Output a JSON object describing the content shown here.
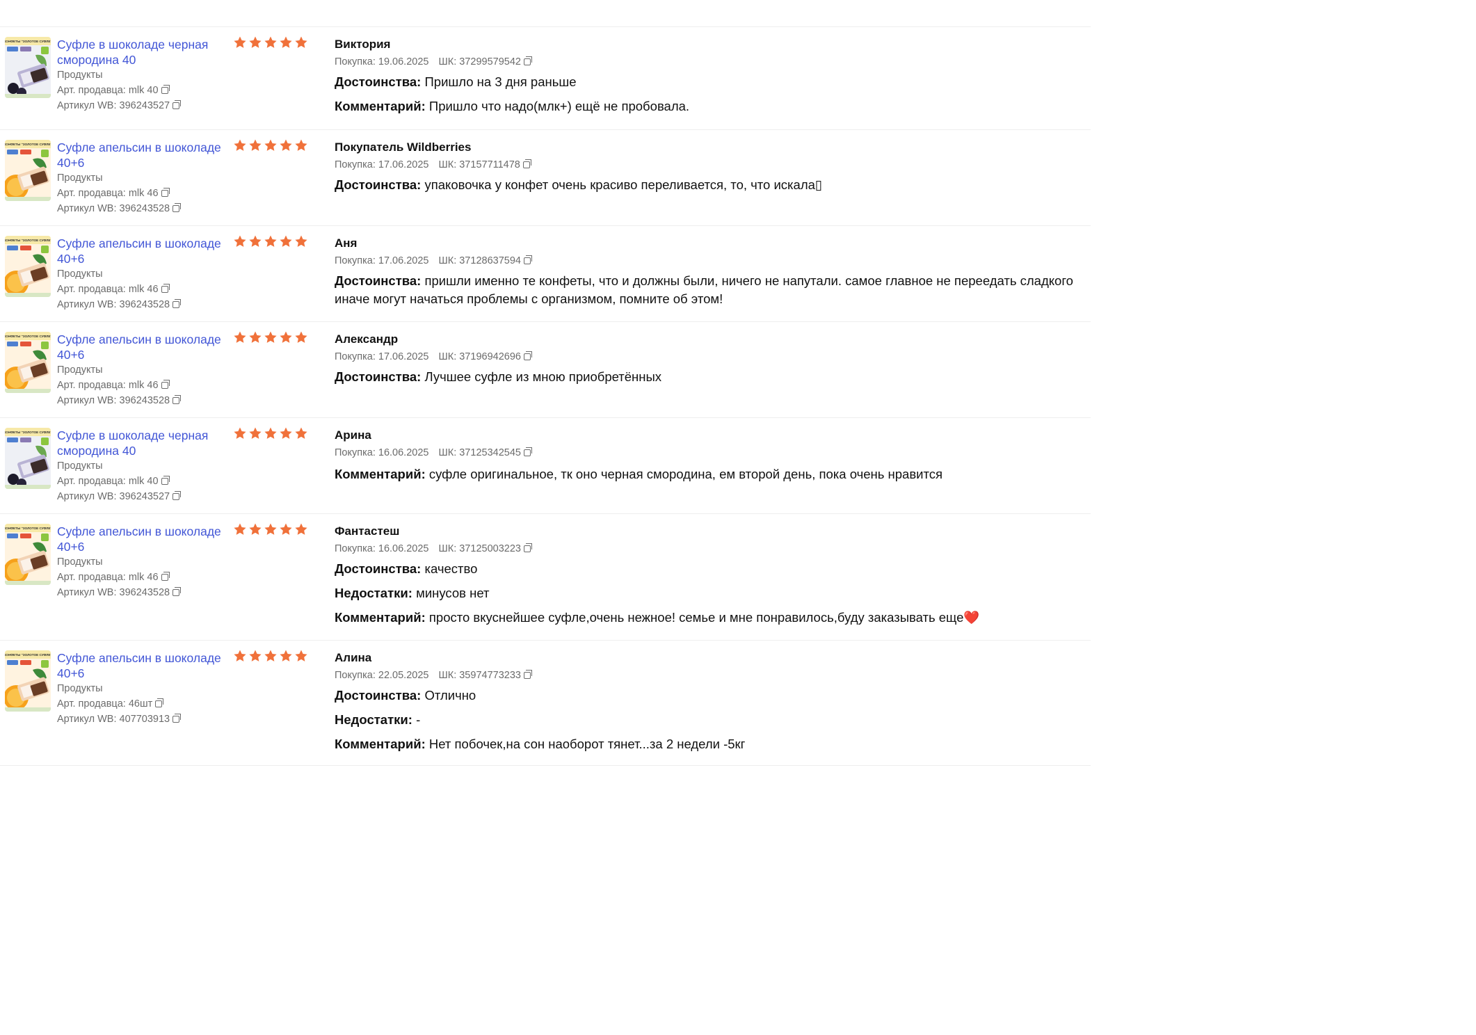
{
  "colors": {
    "link": "#4256d6",
    "star": "#f0713a",
    "muted": "#6b6b6b"
  },
  "reviews": [
    {
      "product_title": "Суфле в шоколаде черная смородина 40",
      "category": "Продукты",
      "seller_article": "Арт. продавца: mlk 40",
      "wb_article": "Артикул WB: 396243527",
      "thumb_variant": "currant",
      "thumb_text": "КОНФЕТЫ \"ЗОЛОТОЕ СУФЛЕ\"",
      "rating": 5,
      "author": "Виктория",
      "purchase": "Покупка: 19.06.2025",
      "barcode": "ШК: 37299579542",
      "pros_label": "Достоинства:",
      "pros": "Пришло на 3 дня раньше",
      "cons_label": "",
      "cons": "",
      "comment_label": "Комментарий:",
      "comment": "Пришло что надо(млк+) ещё не пробовала."
    },
    {
      "product_title": "Суфле апельсин в шоколаде 40+6",
      "category": "Продукты",
      "seller_article": "Арт. продавца: mlk 46",
      "wb_article": "Артикул WB: 396243528",
      "thumb_variant": "orange",
      "thumb_text": "КОНФЕТЫ \"ЗОЛОТОЕ СУФЛЕ\"",
      "rating": 5,
      "author": "Покупатель Wildberries",
      "purchase": "Покупка: 17.06.2025",
      "barcode": "ШК: 37157711478",
      "pros_label": "Достоинства:",
      "pros": "упаковочка у конфет очень красиво переливается, то, что искала▯",
      "cons_label": "",
      "cons": "",
      "comment_label": "",
      "comment": ""
    },
    {
      "product_title": "Суфле апельсин в шоколаде 40+6",
      "category": "Продукты",
      "seller_article": "Арт. продавца: mlk 46",
      "wb_article": "Артикул WB: 396243528",
      "thumb_variant": "orange",
      "thumb_text": "КОНФЕТЫ \"ЗОЛОТОЕ СУФЛЕ\"",
      "rating": 5,
      "author": "Аня",
      "purchase": "Покупка: 17.06.2025",
      "barcode": "ШК: 37128637594",
      "pros_label": "Достоинства:",
      "pros": "пришли именно те конфеты, что и должны были, ничего не напутали. самое главное не переедать сладкого иначе могут начаться проблемы с организмом, помните об этом!",
      "cons_label": "",
      "cons": "",
      "comment_label": "",
      "comment": ""
    },
    {
      "product_title": "Суфле апельсин в шоколаде 40+6",
      "category": "Продукты",
      "seller_article": "Арт. продавца: mlk 46",
      "wb_article": "Артикул WB: 396243528",
      "thumb_variant": "orange",
      "thumb_text": "КОНФЕТЫ \"ЗОЛОТОЕ СУФЛЕ\"",
      "rating": 5,
      "author": "Александр",
      "purchase": "Покупка: 17.06.2025",
      "barcode": "ШК: 37196942696",
      "pros_label": "Достоинства:",
      "pros": "Лучшее суфле из мною приобретённых",
      "cons_label": "",
      "cons": "",
      "comment_label": "",
      "comment": ""
    },
    {
      "product_title": "Суфле в шоколаде черная смородина 40",
      "category": "Продукты",
      "seller_article": "Арт. продавца: mlk 40",
      "wb_article": "Артикул WB: 396243527",
      "thumb_variant": "currant",
      "thumb_text": "КОНФЕТЫ \"ЗОЛОТОЕ СУФЛЕ\"",
      "rating": 5,
      "author": "Арина",
      "purchase": "Покупка: 16.06.2025",
      "barcode": "ШК: 37125342545",
      "pros_label": "",
      "pros": "",
      "cons_label": "",
      "cons": "",
      "comment_label": "Комментарий:",
      "comment": "суфле оригинальное, тк оно черная смородина, ем второй день, пока очень нравится"
    },
    {
      "product_title": "Суфле апельсин в шоколаде 40+6",
      "category": "Продукты",
      "seller_article": "Арт. продавца: mlk 46",
      "wb_article": "Артикул WB: 396243528",
      "thumb_variant": "orange",
      "thumb_text": "КОНФЕТЫ \"ЗОЛОТОЕ СУФЛЕ\"",
      "rating": 5,
      "author": "Фантастеш",
      "purchase": "Покупка: 16.06.2025",
      "barcode": "ШК: 37125003223",
      "pros_label": "Достоинства:",
      "pros": "качество",
      "cons_label": "Недостатки:",
      "cons": "минусов нет",
      "comment_label": "Комментарий:",
      "comment": "просто вкуснейшее суфле,очень нежное! семье и мне понравилось,буду заказывать еще❤️"
    },
    {
      "product_title": "Суфле апельсин в шоколаде 40+6",
      "category": "Продукты",
      "seller_article": "Арт. продавца: 46шт",
      "wb_article": "Артикул WB: 407703913",
      "thumb_variant": "orange",
      "thumb_text": "КОНФЕТЫ \"ЗОЛОТОЕ СУФЛЕ\"",
      "rating": 5,
      "author": "Алина",
      "purchase": "Покупка: 22.05.2025",
      "barcode": "ШК: 35974773233",
      "pros_label": "Достоинства:",
      "pros": "Отлично",
      "cons_label": "Недостатки:",
      "cons": "-",
      "comment_label": "Комментарий:",
      "comment": "Нет побочек,на сон наоборот тянет...за 2 недели -5кг"
    }
  ]
}
